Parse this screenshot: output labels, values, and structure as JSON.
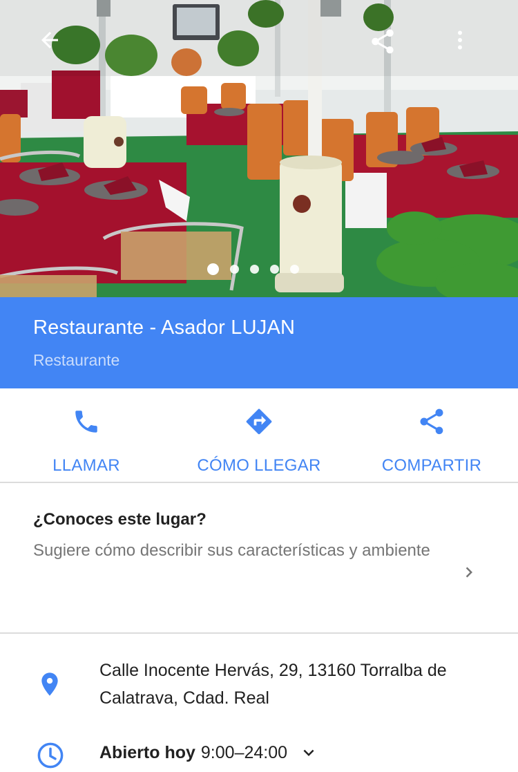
{
  "hero": {
    "photo_description_icons": [
      "back-arrow-icon",
      "share-icon",
      "more-vert-icon"
    ],
    "photo_count": 5,
    "active_photo": 1
  },
  "place": {
    "name": "Restaurante - Asador LUJAN",
    "category": "Restaurante"
  },
  "actions": [
    {
      "label": "LLAMAR",
      "icon": "phone-icon"
    },
    {
      "label": "CÓMO LLEGAR",
      "icon": "directions-icon"
    },
    {
      "label": "COMPARTIR",
      "icon": "share-icon"
    }
  ],
  "suggest": {
    "title": "¿Conoces este lugar?",
    "body": "Sugiere cómo describir sus características y ambiente",
    "icon": "chevron-right-icon"
  },
  "info": {
    "address": "Calle Inocente Hervás, 29, 13160 Torralba de Calatrava, Cdad. Real",
    "address_icon": "location-pin-icon",
    "hours_status": "Abierto hoy",
    "hours_range": "9:00–24:00",
    "hours_icon": "clock-icon",
    "expand_icon": "chevron-down-icon"
  },
  "colors": {
    "accent": "#4285f4",
    "header_band": "#4285f4",
    "subtitle_on_band": "#c9dcfc",
    "divider": "#dcdcdc",
    "secondary_text": "#757575"
  }
}
